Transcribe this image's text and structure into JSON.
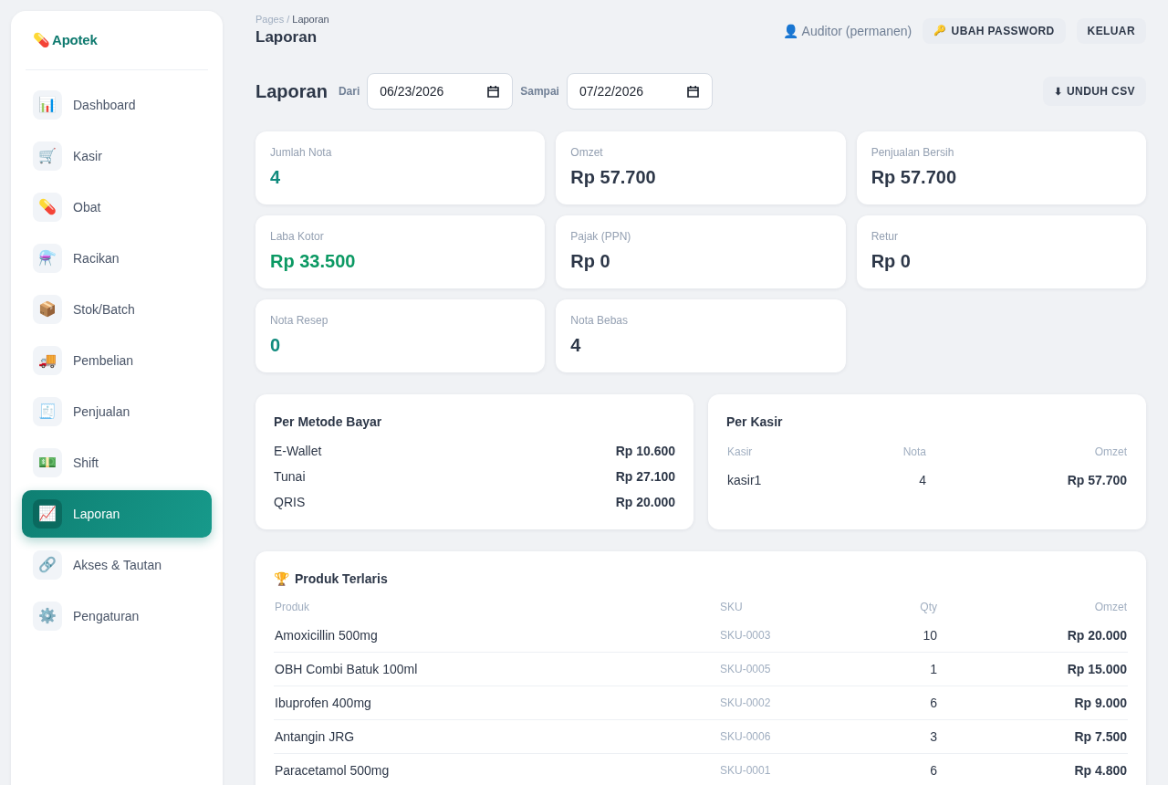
{
  "sidebar": {
    "brand": {
      "icon": "💊",
      "name": "Apotek"
    },
    "items": [
      {
        "icon": "📊",
        "label": "Dashboard",
        "selected": false
      },
      {
        "icon": "🛒",
        "label": "Kasir",
        "selected": false
      },
      {
        "icon": "💊",
        "label": "Obat",
        "selected": false
      },
      {
        "icon": "⚗️",
        "label": "Racikan",
        "selected": false
      },
      {
        "icon": "📦",
        "label": "Stok/Batch",
        "selected": false
      },
      {
        "icon": "🚚",
        "label": "Pembelian",
        "selected": false
      },
      {
        "icon": "🧾",
        "label": "Penjualan",
        "selected": false
      },
      {
        "icon": "💵",
        "label": "Shift",
        "selected": false
      },
      {
        "icon": "📈",
        "label": "Laporan",
        "selected": true
      },
      {
        "icon": "🔗",
        "label": "Akses & Tautan",
        "selected": false
      },
      {
        "icon": "⚙️",
        "label": "Pengaturan",
        "selected": false
      }
    ]
  },
  "header": {
    "breadcrumb": {
      "parent": "Pages",
      "separator": "/",
      "current": "Laporan"
    },
    "title": "Laporan",
    "user": {
      "icon": "👤",
      "name": "Auditor (permanen)"
    },
    "buttons": [
      {
        "icon": "🔑",
        "label": "UBAH PASSWORD"
      },
      {
        "label": "KELUAR"
      }
    ]
  },
  "filter": {
    "title": "Laporan",
    "from": {
      "label": "Dari",
      "value": "06/23/2026"
    },
    "to": {
      "label": "Sampai",
      "value": "07/22/2026"
    },
    "export": {
      "icon": "⬇",
      "label": "UNDUH CSV"
    }
  },
  "stats": [
    {
      "label": "Jumlah Nota",
      "value": "4",
      "color": "#0f8a7d"
    },
    {
      "label": "Omzet",
      "value": "Rp 57.700",
      "color": "#2d3748"
    },
    {
      "label": "Penjualan Bersih",
      "value": "Rp 57.700",
      "color": "#2d3748"
    },
    {
      "label": "Laba Kotor",
      "value": "Rp 33.500",
      "color": "#0b9963"
    },
    {
      "label": "Pajak (PPN)",
      "value": "Rp 0",
      "color": "#2d3748"
    },
    {
      "label": "Retur",
      "value": "Rp 0",
      "color": "#2d3748"
    },
    {
      "label": "Nota Resep",
      "value": "0",
      "color": "#0f8a7d"
    },
    {
      "label": "Nota Bebas",
      "value": "4",
      "color": "#2d3748"
    }
  ],
  "payment_methods": {
    "title": "Per Metode Bayar",
    "rows": [
      {
        "method": "E-Wallet",
        "amount": "Rp 10.600"
      },
      {
        "method": "Tunai",
        "amount": "Rp 27.100"
      },
      {
        "method": "QRIS",
        "amount": "Rp 20.000"
      }
    ]
  },
  "cashiers": {
    "title": "Per Kasir",
    "columns": [
      "Kasir",
      "Nota",
      "Omzet"
    ],
    "rows": [
      [
        "kasir1",
        "4",
        "Rp 57.700"
      ]
    ]
  },
  "top_products": {
    "icon": "🏆",
    "title": "Produk Terlaris",
    "columns": [
      "Produk",
      "SKU",
      "Qty",
      "Omzet"
    ],
    "rows": [
      [
        "Amoxicillin 500mg",
        "SKU-0003",
        "10",
        "Rp 20.000"
      ],
      [
        "OBH Combi Batuk 100ml",
        "SKU-0005",
        "1",
        "Rp 15.000"
      ],
      [
        "Ibuprofen 400mg",
        "SKU-0002",
        "6",
        "Rp 9.000"
      ],
      [
        "Antangin JRG",
        "SKU-0006",
        "3",
        "Rp 7.500"
      ],
      [
        "Paracetamol 500mg",
        "SKU-0001",
        "6",
        "Rp 4.800"
      ]
    ]
  }
}
